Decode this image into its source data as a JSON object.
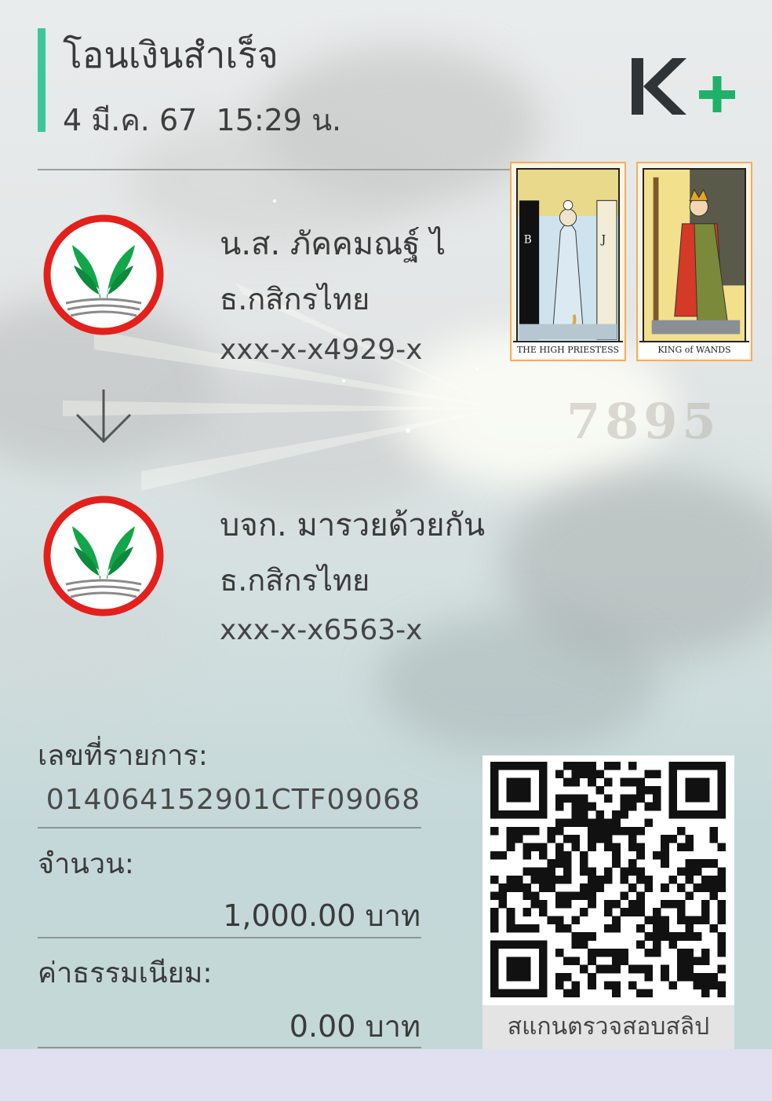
{
  "header": {
    "title": "โอนเงินสำเร็จ",
    "datetime": "4 มี.ค. 67  15:29 น.",
    "brand_logo": "K+",
    "accent_color": "#3cc79a",
    "brand_green": "#1fb16a"
  },
  "decoration": {
    "tarot_cards": [
      {
        "caption": "THE HIGH PRIESTESS",
        "icon": "high-priestess-card"
      },
      {
        "caption": "KING of WANDS",
        "icon": "king-of-wands-card"
      }
    ],
    "lucky_number": "7895"
  },
  "sender": {
    "name": "น.ส. ภัคคมณฐ์ ไ",
    "bank": "ธ.กสิกรไทย",
    "account": "xxx-x-x4929-x",
    "logo_icon": "kasikorn-bank-logo"
  },
  "transfer_arrow_icon": "arrow-down-icon",
  "receiver": {
    "name": "บจก. มารวยด้วยกัน",
    "bank": "ธ.กสิกรไทย",
    "account": "xxx-x-x6563-x",
    "logo_icon": "kasikorn-bank-logo"
  },
  "details": {
    "transaction_id_label": "เลขที่รายการ:",
    "transaction_id": "014064152901CTF09068",
    "amount_label": "จำนวน:",
    "amount": "1,000.00 บาท",
    "fee_label": "ค่าธรรมเนียม:",
    "fee": "0.00 บาท"
  },
  "qr": {
    "caption": "สแกนตรวจสอบสลิป",
    "icon": "qr-code-icon"
  }
}
